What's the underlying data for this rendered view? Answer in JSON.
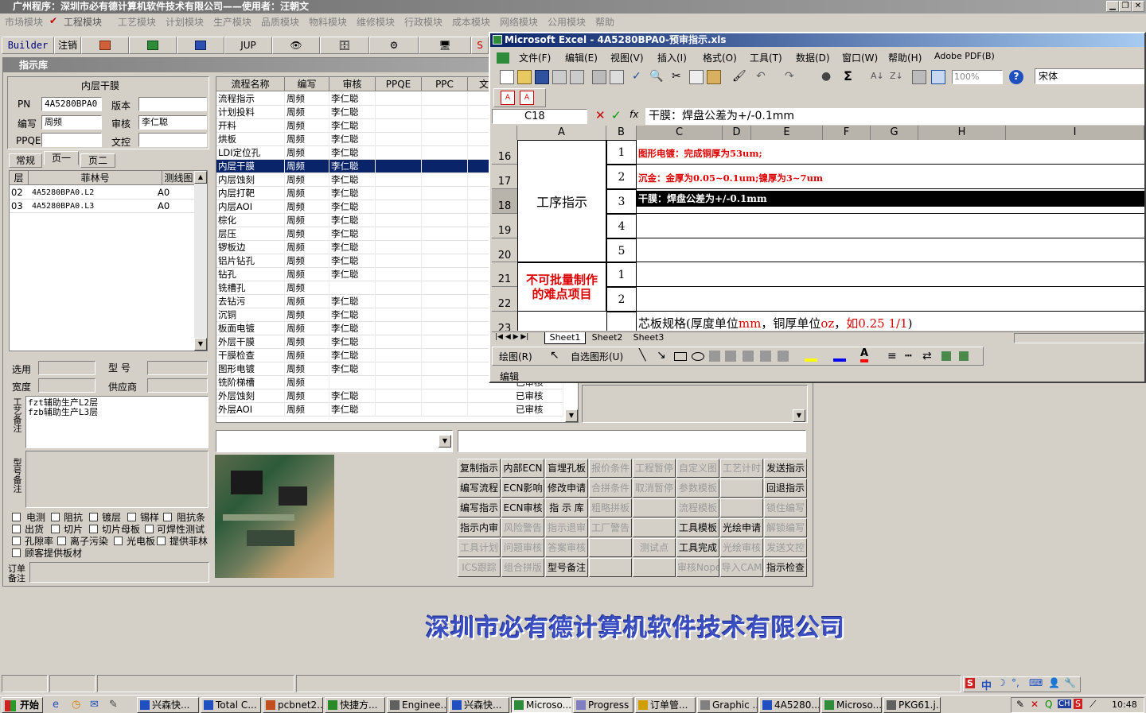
{
  "app": {
    "title": "广州程序：深圳市必有德计算机软件技术有限公司——使用者：汪朝文"
  },
  "menu": [
    "市场模块",
    "工程模块",
    "工艺模块",
    "计划模块",
    "生产模块",
    "品质模块",
    "物料模块",
    "维修模块",
    "行政模块",
    "成本模块",
    "网络模块",
    "公用模块",
    "帮助"
  ],
  "toolbar": {
    "builder": "Builder",
    "logout": "注销",
    "jup": "JUP",
    "s": "S"
  },
  "inner": {
    "title": "指示库"
  },
  "left": {
    "header": "内层干膜",
    "pn_label": "PN",
    "pn": "4A5280BPA0",
    "version_label": "版本",
    "version": "",
    "writer_label": "编写",
    "writer": "周频",
    "review_label": "审核",
    "review": "李仁聪",
    "ppqe_label": "PPQE",
    "ppqe": "",
    "doc_label": "文控",
    "doc": "",
    "tabs": [
      "常规",
      "页一",
      "页二"
    ],
    "layer_headers": [
      "层",
      "菲林号",
      "测线图"
    ],
    "layers": [
      [
        "02",
        "4A5280BPA0.L2",
        "A0"
      ],
      [
        "03",
        "4A5280BPA0.L3",
        "A0"
      ]
    ],
    "sel_label": "选用",
    "model_label": "型 号",
    "width_label": "宽度",
    "supplier_label": "供应商",
    "craft_label": "工艺备注",
    "craft_notes": [
      "fzt辅助生产L2层",
      "fzb辅助生产L3层"
    ],
    "model_note_label": "型号备注",
    "checks": [
      [
        "电测",
        "阻抗",
        "镀层",
        "锡样",
        "阻抗条"
      ],
      [
        "出货",
        "切片",
        "切片母板",
        "可焊性测试"
      ],
      [
        "孔隙率",
        "离子污染",
        "光电板",
        "提供菲林"
      ],
      [
        "顾客提供板材"
      ]
    ],
    "order_label": "订单备注"
  },
  "flow": {
    "headers": [
      "流程名称",
      "编写",
      "审核",
      "PPQE",
      "PPC",
      "文"
    ],
    "rows": [
      [
        "流程指示",
        "周频",
        "李仁聪",
        ""
      ],
      [
        "计划投料",
        "周频",
        "李仁聪",
        ""
      ],
      [
        "开料",
        "周频",
        "李仁聪",
        ""
      ],
      [
        "烘板",
        "周频",
        "李仁聪",
        ""
      ],
      [
        "LDI定位孔",
        "周频",
        "李仁聪",
        ""
      ],
      [
        "内层干膜",
        "周频",
        "李仁聪",
        ""
      ],
      [
        "内层蚀刻",
        "周频",
        "李仁聪",
        ""
      ],
      [
        "内层打靶",
        "周频",
        "李仁聪",
        ""
      ],
      [
        "内层AOI",
        "周频",
        "李仁聪",
        ""
      ],
      [
        "棕化",
        "周频",
        "李仁聪",
        ""
      ],
      [
        "层压",
        "周频",
        "李仁聪",
        ""
      ],
      [
        "锣板边",
        "周频",
        "李仁聪",
        ""
      ],
      [
        "铝片钻孔",
        "周频",
        "李仁聪",
        ""
      ],
      [
        "钻孔",
        "周频",
        "李仁聪",
        ""
      ],
      [
        "铣槽孔",
        "周频",
        "",
        ""
      ],
      [
        "去钻污",
        "周频",
        "李仁聪",
        ""
      ],
      [
        "沉铜",
        "周频",
        "李仁聪",
        ""
      ],
      [
        "板面电镀",
        "周频",
        "李仁聪",
        ""
      ],
      [
        "外层干膜",
        "周频",
        "李仁聪",
        ""
      ],
      [
        "干膜检查",
        "周频",
        "李仁聪",
        ""
      ],
      [
        "图形电镀",
        "周频",
        "李仁聪",
        ""
      ],
      [
        "铣阶梯槽",
        "周频",
        "",
        "已审核"
      ],
      [
        "外层蚀刻",
        "周频",
        "李仁聪",
        "已审核"
      ],
      [
        "外层AOI",
        "周频",
        "李仁聪",
        "已审核"
      ]
    ]
  },
  "buttons": [
    [
      "复制指示",
      "内部ECN",
      "盲埋孔板",
      "报价条件",
      "工程暂停",
      "自定义图",
      "工艺计时",
      "发送指示"
    ],
    [
      "编写流程",
      "ECN影响",
      "修改申请",
      "合拼条件",
      "取消暂停",
      "参数模板",
      "",
      "回退指示"
    ],
    [
      "编写指示",
      "ECN审核",
      "指 示 库",
      "粗略拼板",
      "",
      "流程模板",
      "",
      "锁住编写"
    ],
    [
      "指示内审",
      "风险警告",
      "指示退审",
      "工厂警告",
      "",
      "工具模板",
      "光绘申请",
      "解锁编写"
    ],
    [
      "工具计划",
      "问题审核",
      "答案审核",
      "",
      "测试点",
      "工具完成",
      "光绘审核",
      "发送文控"
    ],
    [
      "ICS跟踪",
      "组合拼版",
      "型号备注",
      "",
      "",
      "审核Nope",
      "导入CAM",
      "指示检查"
    ]
  ],
  "buttons_enabled": [
    [
      1,
      1,
      1,
      0,
      0,
      0,
      0,
      1
    ],
    [
      1,
      1,
      1,
      0,
      0,
      0,
      0,
      1
    ],
    [
      1,
      1,
      1,
      0,
      0,
      0,
      0,
      0
    ],
    [
      1,
      0,
      0,
      0,
      0,
      1,
      1,
      0
    ],
    [
      0,
      0,
      0,
      0,
      0,
      1,
      0,
      0
    ],
    [
      0,
      0,
      1,
      0,
      0,
      0,
      0,
      1
    ]
  ],
  "excel": {
    "title": "Microsoft Excel - 4A5280BPA0-预审指示.xls",
    "menu": [
      "文件(F)",
      "编辑(E)",
      "视图(V)",
      "插入(I)",
      "格式(O)",
      "工具(T)",
      "数据(D)",
      "窗口(W)",
      "帮助(H)",
      "Adobe PDF(B)"
    ],
    "zoom": "100%",
    "font": "宋体",
    "cellref": "C18",
    "formula": "干膜：焊盘公差为+/-0.1mm",
    "cols": [
      "A",
      "B",
      "C",
      "D",
      "E",
      "F",
      "G",
      "H",
      "I"
    ],
    "rows": [
      "16",
      "17",
      "18",
      "19",
      "20",
      "21",
      "22",
      "23"
    ],
    "merged_a1": "工序指示",
    "merged_a2": "不可批量制作的难点项目",
    "b_vals": [
      "1",
      "2",
      "3",
      "4",
      "5",
      "1",
      "2",
      ""
    ],
    "c16": "图形电镀：完成铜厚为53um;",
    "c17": "沉金：金厚为0.05~0.1um;镍厚为3~7um",
    "c18": "干膜：焊盘公差为+/-0.1mm",
    "c23a": "芯板规格(厚度单位",
    "c23b": "mm",
    "c23c": "，铜厚单位",
    "c23d": "oz",
    "c23e": "，",
    "c23f": "如0.25 1/1",
    ")": ")",
    "sheets": [
      "Sheet1",
      "Sheet2",
      "Sheet3"
    ],
    "draw": "绘图(R)",
    "autoshape": "自选图形(U)",
    "status": "编辑"
  },
  "logo": "深圳市必有德计算机软件技术有限公司",
  "taskbar": {
    "start": "开始",
    "tasks": [
      "兴森快...",
      "Total C...",
      "pcbnet2...",
      "快捷方...",
      "Enginee...",
      "兴森快...",
      "Microso...",
      "Progress",
      "订单管...",
      "Graphic ...",
      "4A5280...",
      "Microso...",
      "PKG61.j..."
    ],
    "clock": "10:48"
  }
}
